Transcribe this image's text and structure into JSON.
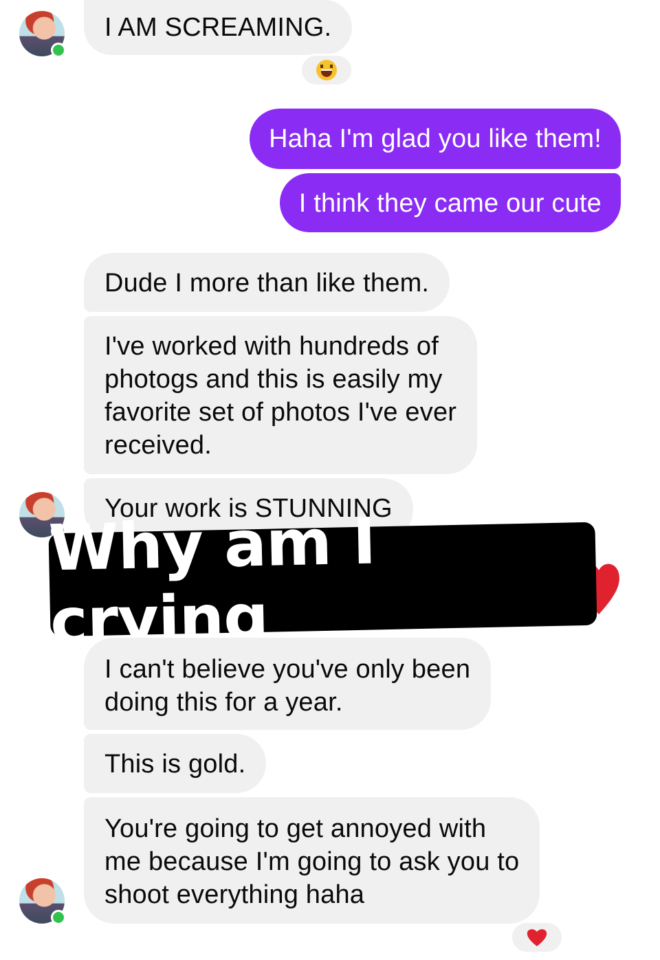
{
  "messages": {
    "m1": "I AM SCREAMING.",
    "m2": "Haha I'm glad you like them!",
    "m3": "I think they came our cute",
    "m4": "Dude I more than like them.",
    "m5": "I've worked with hundreds of\nphotogs and this is easily my\nfavorite set of photos I've ever\nreceived.",
    "m6": "Your work is STUNNING",
    "m7": "I can't believe you've only been\ndoing this for a year.",
    "m8": "This is gold.",
    "m9": "You're going to get annoyed with\nme because I'm going to ask you to\nshoot everything haha"
  },
  "reactions": {
    "first": "laughing-emoji",
    "last": "heart-emoji"
  },
  "overlay_caption": "Why am I crying",
  "colors": {
    "outgoing_bubble": "#8a2cf4",
    "incoming_bubble": "#f0f0f0",
    "online_dot": "#31c24d",
    "heart": "#e0212e"
  }
}
